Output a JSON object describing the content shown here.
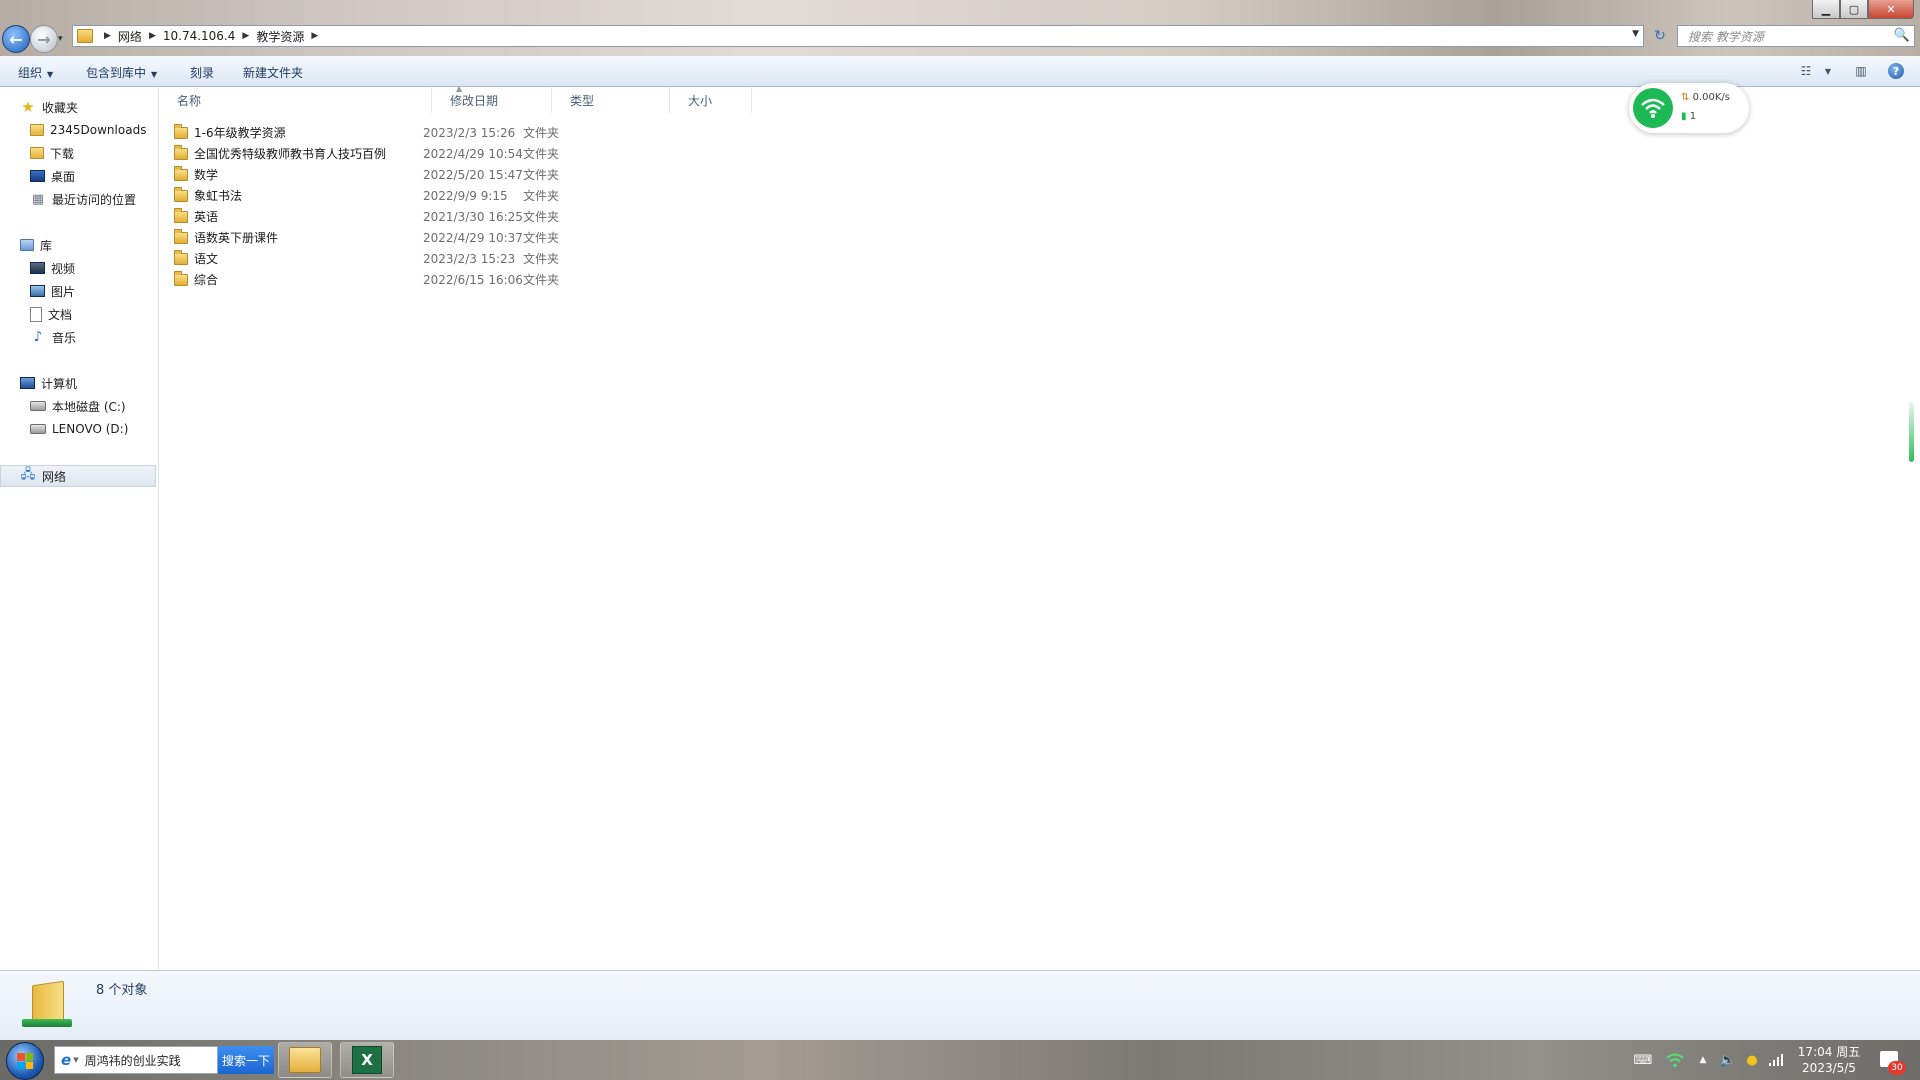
{
  "window": {
    "controls": {
      "minimize": "▁",
      "maximize": "▢",
      "close": "✕"
    }
  },
  "nav": {
    "back_icon": "←",
    "forward_icon": "→",
    "history_icon": "▾"
  },
  "address": {
    "crumbs": [
      "网络",
      "10.74.106.4",
      "教学资源"
    ],
    "refresh_icon": "↻"
  },
  "search": {
    "placeholder": "搜索 教学资源",
    "icon": "🔍"
  },
  "toolbar": {
    "organize": "组织",
    "include_library": "包含到库中",
    "burn": "刻录",
    "new_folder": "新建文件夹",
    "help": "?"
  },
  "sidebar": {
    "favorites": {
      "label": "收藏夹",
      "items": [
        "2345Downloads",
        "下载",
        "桌面",
        "最近访问的位置"
      ]
    },
    "libraries": {
      "label": "库",
      "items": [
        "视频",
        "图片",
        "文档",
        "音乐"
      ]
    },
    "computer": {
      "label": "计算机",
      "items": [
        "本地磁盘 (C:)",
        "LENOVO (D:)"
      ]
    },
    "network": {
      "label": "网络"
    }
  },
  "columns": {
    "name": "名称",
    "date": "修改日期",
    "type": "类型",
    "size": "大小"
  },
  "files": [
    {
      "name": "1-6年级教学资源",
      "date": "2023/2/3 15:26",
      "type": "文件夹"
    },
    {
      "name": "全国优秀特级教师教书育人技巧百例",
      "date": "2022/4/29 10:54",
      "type": "文件夹"
    },
    {
      "name": "数学",
      "date": "2022/5/20 15:47",
      "type": "文件夹"
    },
    {
      "name": "象虹书法",
      "date": "2022/9/9 9:15",
      "type": "文件夹"
    },
    {
      "name": "英语",
      "date": "2021/3/30 16:25",
      "type": "文件夹"
    },
    {
      "name": "语数英下册课件",
      "date": "2022/4/29 10:37",
      "type": "文件夹"
    },
    {
      "name": "语文",
      "date": "2023/2/3 15:23",
      "type": "文件夹"
    },
    {
      "name": "综合",
      "date": "2022/6/15 16:06",
      "type": "文件夹"
    }
  ],
  "wifi": {
    "speed": "0.00K/s",
    "count": "1"
  },
  "details": {
    "count": "8 个对象"
  },
  "taskbar": {
    "search_query": "周鸿祎的创业实践",
    "search_button": "搜索一下",
    "time": "17:04 周五",
    "date": "2023/5/5",
    "notification_count": "30"
  }
}
